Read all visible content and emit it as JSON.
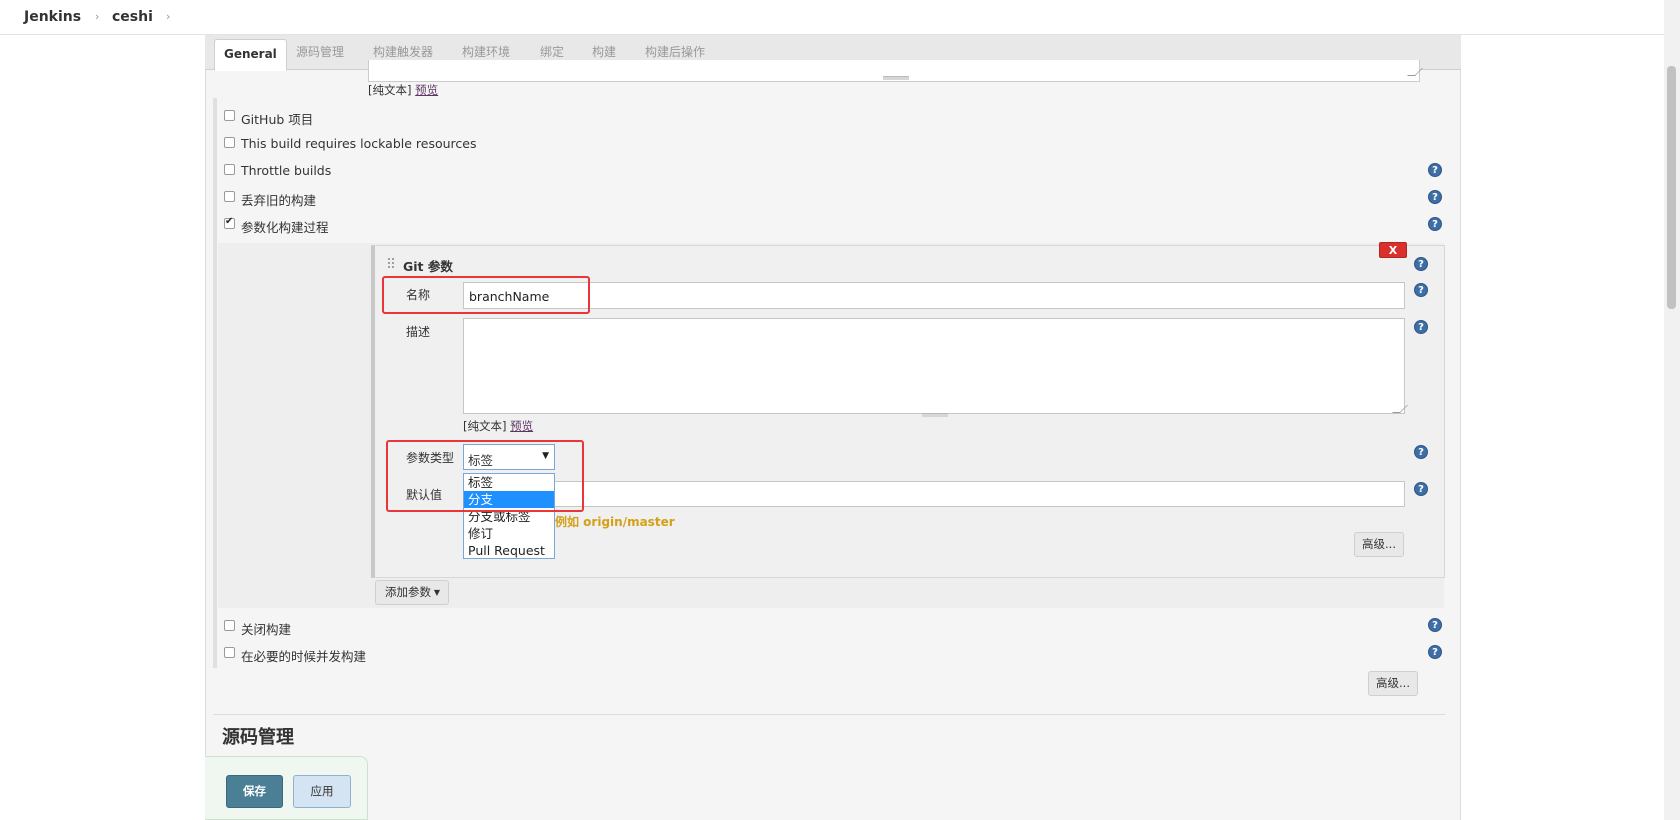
{
  "breadcrumb": {
    "root": "Jenkins",
    "job": "ceshi",
    "separator": "›"
  },
  "tabs": [
    "General",
    "源码管理",
    "构建触发器",
    "构建环境",
    "绑定",
    "构建",
    "构建后操作"
  ],
  "format_note": {
    "prefix": "[纯文本]",
    "link": "预览"
  },
  "options": {
    "github_project": "GitHub 项目",
    "lockable_resources": "This build requires lockable resources",
    "throttle_builds": "Throttle builds",
    "discard_old_builds": "丢弃旧的构建",
    "parameterized_build": "参数化构建过程",
    "disable_build": "关闭构建",
    "concurrent_builds": "在必要的时候并发构建"
  },
  "git_parameter": {
    "title": "Git 参数",
    "delete_label": "X",
    "name_label": "名称",
    "name_value": "branchName",
    "description_label": "描述",
    "param_type_label": "参数类型",
    "param_type_selected": "标签",
    "param_type_options": [
      "标签",
      "分支",
      "分支或标签",
      "修订",
      "Pull Request"
    ],
    "default_value_label": "默认值",
    "default_value_hint": "例如 origin/master",
    "advanced_button": "高级..."
  },
  "add_parameter_button": "添加参数",
  "advanced_button": "高级...",
  "help_glyph": "?",
  "section_title": "源码管理",
  "actions": {
    "save": "保存",
    "apply": "应用"
  },
  "colors": {
    "highlight_box": "#e8363a",
    "save_button": "#4a7f96",
    "hint": "#d4a017",
    "selected_option": "#1e90ff"
  }
}
